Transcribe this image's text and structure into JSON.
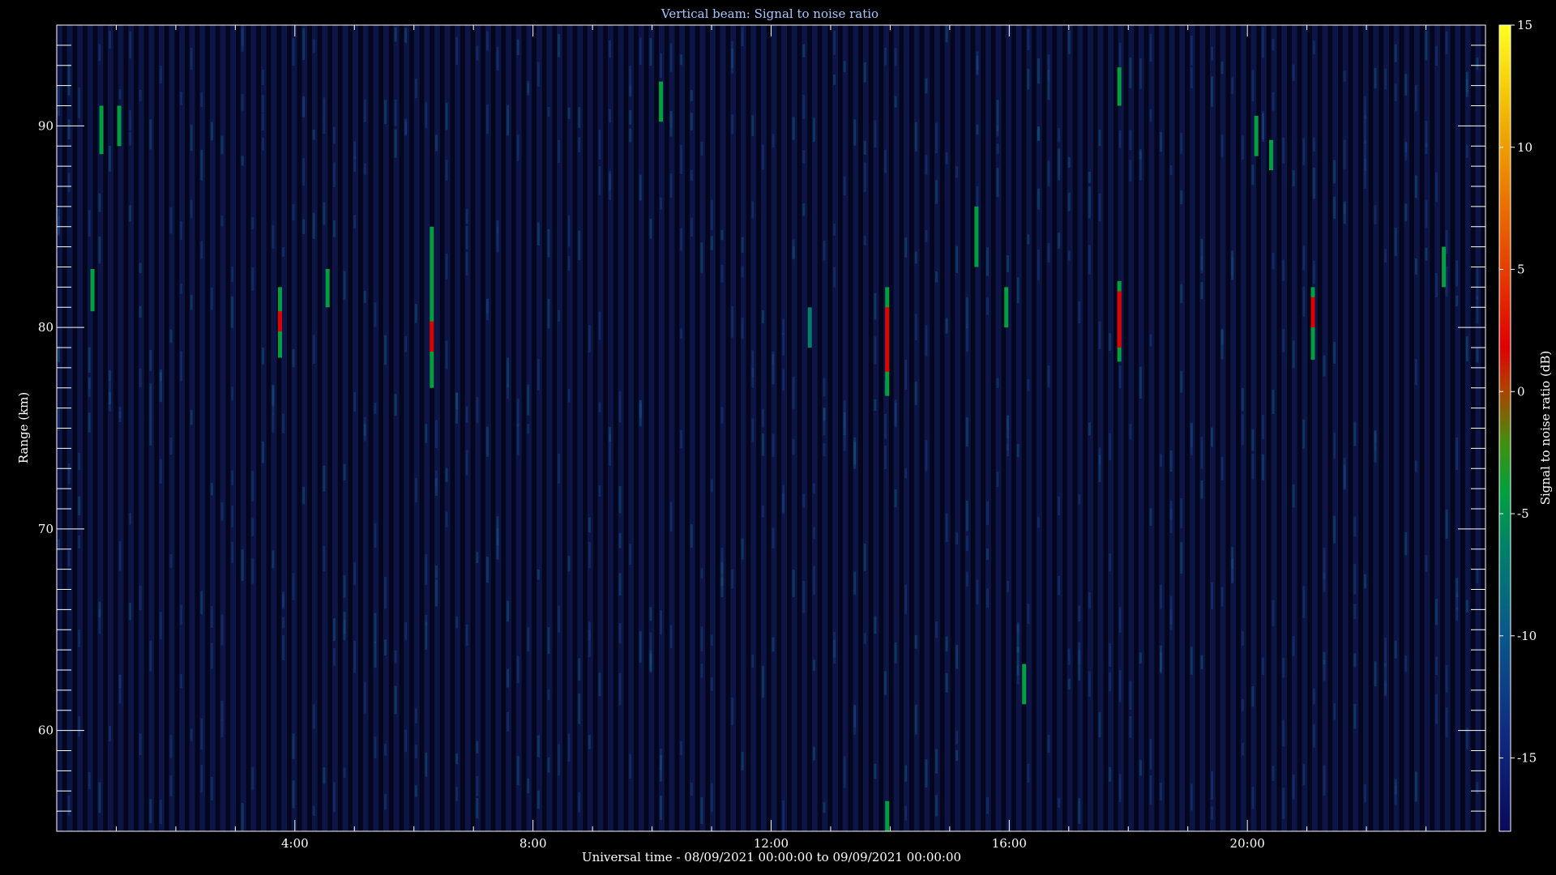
{
  "chart_data": {
    "type": "heatmap",
    "title": "Vertical beam: Signal to noise ratio",
    "xlabel": "Universal time - 08/09/2021 00:00:00 to 09/09/2021 00:00:00",
    "ylabel": "Range (km)",
    "colorbar_label": "Signal to noise ratio (dB)",
    "x_unit": "hours UT",
    "xlim": [
      0,
      24
    ],
    "ylim": [
      55,
      95
    ],
    "x_ticks": [
      {
        "value": 4,
        "label": "4:00"
      },
      {
        "value": 8,
        "label": "8:00"
      },
      {
        "value": 12,
        "label": "12:00"
      },
      {
        "value": 16,
        "label": "16:00"
      },
      {
        "value": 20,
        "label": "20:00"
      }
    ],
    "y_ticks": [
      {
        "value": 60,
        "label": "60"
      },
      {
        "value": 70,
        "label": "70"
      },
      {
        "value": 80,
        "label": "80"
      },
      {
        "value": 90,
        "label": "90"
      }
    ],
    "colorbar_range": [
      -18,
      15
    ],
    "colorbar_ticks": [
      {
        "value": 15,
        "label": "15"
      },
      {
        "value": 10,
        "label": "10"
      },
      {
        "value": 5,
        "label": "5"
      },
      {
        "value": 0,
        "label": "0"
      },
      {
        "value": -5,
        "label": "-5"
      },
      {
        "value": -10,
        "label": "-10"
      },
      {
        "value": -15,
        "label": "-15"
      }
    ],
    "background_snr": -15,
    "features": [
      {
        "time": 0.6,
        "range_min": 80.8,
        "range_max": 82.9,
        "snr": -6
      },
      {
        "time": 0.75,
        "range_min": 88.6,
        "range_max": 91.0,
        "snr": -6
      },
      {
        "time": 1.05,
        "range_min": 89.0,
        "range_max": 91.0,
        "snr": -6
      },
      {
        "time": 3.75,
        "range_min": 78.5,
        "range_max": 82.0,
        "snr": -4
      },
      {
        "time": 3.75,
        "range_min": 79.8,
        "range_max": 80.8,
        "snr": 1
      },
      {
        "time": 4.55,
        "range_min": 81.0,
        "range_max": 82.9,
        "snr": -6
      },
      {
        "time": 6.3,
        "range_min": 77.0,
        "range_max": 85.0,
        "snr": -5
      },
      {
        "time": 6.3,
        "range_min": 78.8,
        "range_max": 80.3,
        "snr": 1
      },
      {
        "time": 10.15,
        "range_min": 90.2,
        "range_max": 92.2,
        "snr": -6
      },
      {
        "time": 12.65,
        "range_min": 79.0,
        "range_max": 81.0,
        "snr": -10
      },
      {
        "time": 13.95,
        "range_min": 76.6,
        "range_max": 82.0,
        "snr": -5
      },
      {
        "time": 13.95,
        "range_min": 77.8,
        "range_max": 81.0,
        "snr": 3
      },
      {
        "time": 13.95,
        "range_min": 55.0,
        "range_max": 56.5,
        "snr": -6
      },
      {
        "time": 15.45,
        "range_min": 83.0,
        "range_max": 86.0,
        "snr": -7
      },
      {
        "time": 15.95,
        "range_min": 80.0,
        "range_max": 82.0,
        "snr": -6
      },
      {
        "time": 16.25,
        "range_min": 61.3,
        "range_max": 63.3,
        "snr": -6
      },
      {
        "time": 17.85,
        "range_min": 78.3,
        "range_max": 82.3,
        "snr": -4
      },
      {
        "time": 17.85,
        "range_min": 79.0,
        "range_max": 81.8,
        "snr": 2
      },
      {
        "time": 17.85,
        "range_min": 91.0,
        "range_max": 92.9,
        "snr": -6
      },
      {
        "time": 20.15,
        "range_min": 88.5,
        "range_max": 90.5,
        "snr": -7
      },
      {
        "time": 20.4,
        "range_min": 87.8,
        "range_max": 89.3,
        "snr": -7
      },
      {
        "time": 21.1,
        "range_min": 78.4,
        "range_max": 82.0,
        "snr": -5
      },
      {
        "time": 21.1,
        "range_min": 80.0,
        "range_max": 81.5,
        "snr": 2
      },
      {
        "time": 23.3,
        "range_min": 82.0,
        "range_max": 84.0,
        "snr": -7
      }
    ]
  }
}
